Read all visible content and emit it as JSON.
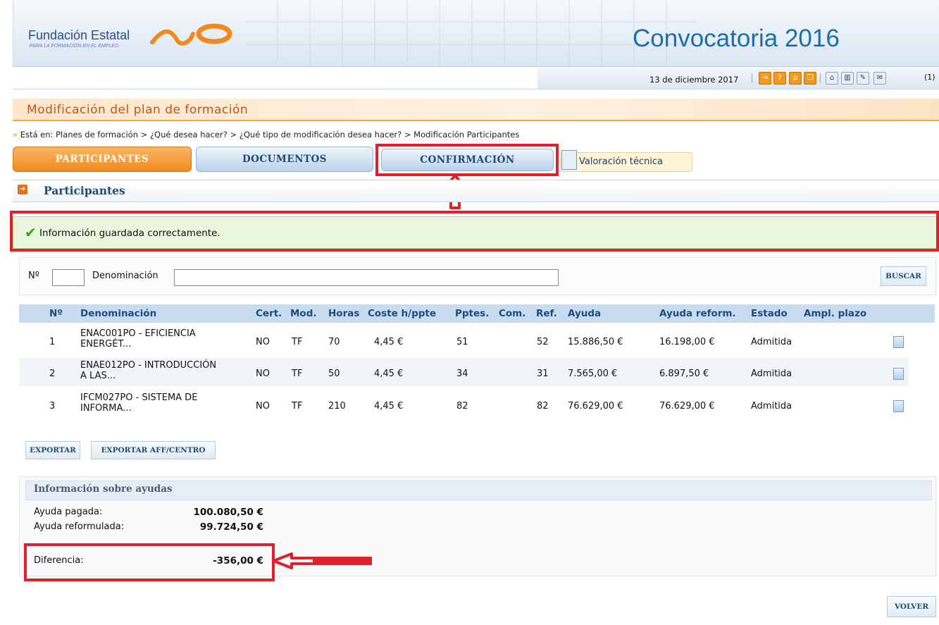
{
  "header": {
    "brand_name": "Fundación Estatal",
    "brand_sub": "PARA LA FORMACIÓN EN EL EMPLEO",
    "title": "Convocatoria 2016"
  },
  "toolbar": {
    "date": "13 de diciembre 2017",
    "message_count": "(1)",
    "icons": [
      "exit-icon",
      "help-icon",
      "home-icon",
      "copy-icon",
      "inbox-icon",
      "chart-icon",
      "edit-icon",
      "mail-icon"
    ]
  },
  "section_title": "Modificación del plan de formación",
  "breadcrumb": {
    "prefix": "Está en:",
    "path": "Planes de formación > ¿Qué desea hacer? > ¿Qué tipo de modificación desea hacer? > Modificación Participantes"
  },
  "tabs": {
    "participantes": "PARTICIPANTES",
    "documentos": "DOCUMENTOS",
    "confirmacion": "CONFIRMACIÓN",
    "valoracion": "Valoración técnica"
  },
  "panel_title": "Participantes",
  "success_message": "Información guardada correctamente.",
  "search": {
    "no_label": "Nº",
    "no_value": "",
    "denominacion_label": "Denominación",
    "denominacion_value": "",
    "button": "BUSCAR"
  },
  "table": {
    "headers": [
      "Nº",
      "Denominación",
      "Cert.",
      "Mod.",
      "Horas",
      "Coste h/ppte",
      "Pptes.",
      "Com.",
      "Ref.",
      "Ayuda",
      "Ayuda reform.",
      "Estado",
      "Ampl. plazo"
    ],
    "rows": [
      {
        "no": "1",
        "den1": "ENAC001PO - EFICIENCIA",
        "den2": "ENERGÉT...",
        "cert": "NO",
        "mod": "TF",
        "horas": "70",
        "coste": "4,45 €",
        "pptes": "51",
        "com": "",
        "ref": "52",
        "ayuda": "15.886,50 €",
        "reform": "16.198,00 €",
        "estado": "Admitida"
      },
      {
        "no": "2",
        "den1": "ENAE012PO - INTRODUCCIÓN",
        "den2": "A LAS...",
        "cert": "NO",
        "mod": "TF",
        "horas": "50",
        "coste": "4,45 €",
        "pptes": "34",
        "com": "",
        "ref": "31",
        "ayuda": "7.565,00 €",
        "reform": "6.897,50 €",
        "estado": "Admitida"
      },
      {
        "no": "3",
        "den1": "IFCM027PO - SISTEMA DE",
        "den2": "INFORMA...",
        "cert": "NO",
        "mod": "TF",
        "horas": "210",
        "coste": "4,45 €",
        "pptes": "82",
        "com": "",
        "ref": "82",
        "ayuda": "76.629,00 €",
        "reform": "76.629,00 €",
        "estado": "Admitida"
      }
    ]
  },
  "export": {
    "exportar": "EXPORTAR",
    "exportar_aff": "EXPORTAR AFF/CENTRO"
  },
  "ayudas": {
    "title": "Información sobre ayudas",
    "pagada_label": "Ayuda pagada:",
    "pagada_value": "100.080,50 €",
    "reformulada_label": "Ayuda reformulada:",
    "reformulada_value": "99.724,50 €",
    "diferencia_label": "Diferencia:",
    "diferencia_value": "-356,00 €"
  },
  "volver": "VOLVER",
  "colors": {
    "accent_orange": "#f08a1f",
    "brand_blue": "#1c6ea8",
    "annotation_red": "#e0202a",
    "success_green": "#3d9b1a"
  }
}
